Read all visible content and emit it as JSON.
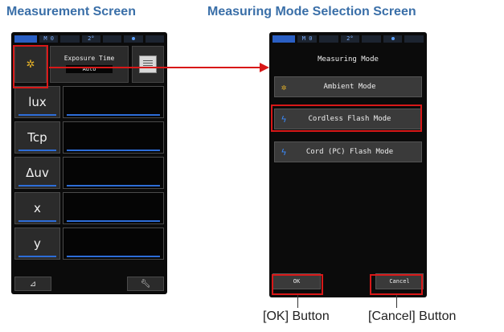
{
  "headings": {
    "measurement": "Measurement Screen",
    "selection": "Measuring Mode Selection Screen"
  },
  "statusbar": [
    "M 0",
    "2°"
  ],
  "measurement_screen": {
    "mode_icon": "sun-icon",
    "exposure_label": "Exposure Time",
    "exposure_value": "Auto",
    "memory_icon": "memo-icon",
    "rows": [
      {
        "label": "lux"
      },
      {
        "label": "Tcp"
      },
      {
        "label": "Δuv"
      },
      {
        "label": "x"
      },
      {
        "label": "y"
      }
    ],
    "bottom_left_icon": "delta-icon",
    "bottom_right_icon": "wrench-icon"
  },
  "selection_screen": {
    "title": "Measuring Mode",
    "options": [
      {
        "label": "Ambient Mode",
        "icon": "sun-icon"
      },
      {
        "label": "Cordless Flash Mode",
        "icon": "flash-icon"
      },
      {
        "label": "Cord (PC) Flash Mode",
        "icon": "cord-flash-icon"
      }
    ],
    "ok_label": "OK",
    "cancel_label": "Cancel"
  },
  "callouts": {
    "ok": "[OK] Button",
    "cancel": "[Cancel] Button"
  },
  "colors": {
    "heading": "#3a6fa8",
    "highlight": "#d81818",
    "accent_blue": "#2d6dd8"
  }
}
